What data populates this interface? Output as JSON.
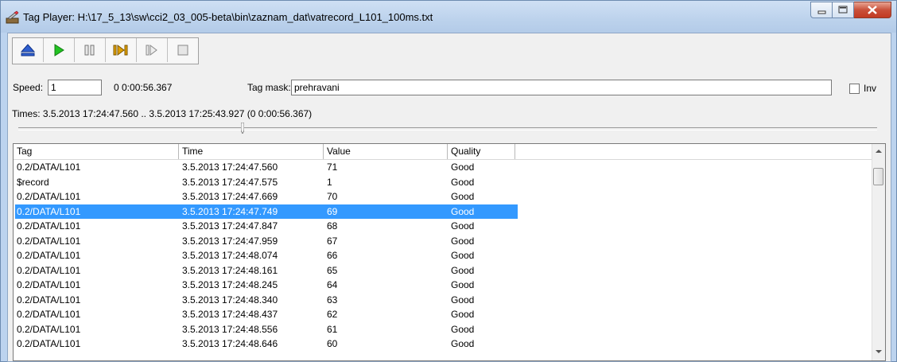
{
  "window": {
    "title": "Tag Player: H:\\17_5_13\\sw\\cci2_03_005-beta\\bin\\zaznam_dat\\vatrecord_L101_100ms.txt"
  },
  "toolbar": {
    "buttons": [
      "eject-icon",
      "play-icon",
      "pause-icon",
      "step-forward-icon",
      "step-icon",
      "stop-icon"
    ]
  },
  "controls": {
    "speed_label": "Speed:",
    "speed_value": "1",
    "position": "0 0:00:56.367",
    "tag_mask_label": "Tag mask:",
    "tag_mask_value": "prehravani",
    "inv_label": "Inv"
  },
  "times": "Times:  3.5.2013 17:24:47.560 .. 3.5.2013 17:25:43.927 (0 0:00:56.367)",
  "table": {
    "columns": [
      "Tag",
      "Time",
      "Value",
      "Quality"
    ],
    "rows": [
      [
        "0.2/DATA/L101",
        "3.5.2013 17:24:47.560",
        "71",
        "Good"
      ],
      [
        "$record",
        "3.5.2013 17:24:47.575",
        "1",
        "Good"
      ],
      [
        "0.2/DATA/L101",
        "3.5.2013 17:24:47.669",
        "70",
        "Good"
      ],
      [
        "0.2/DATA/L101",
        "3.5.2013 17:24:47.749",
        "69",
        "Good"
      ],
      [
        "0.2/DATA/L101",
        "3.5.2013 17:24:47.847",
        "68",
        "Good"
      ],
      [
        "0.2/DATA/L101",
        "3.5.2013 17:24:47.959",
        "67",
        "Good"
      ],
      [
        "0.2/DATA/L101",
        "3.5.2013 17:24:48.074",
        "66",
        "Good"
      ],
      [
        "0.2/DATA/L101",
        "3.5.2013 17:24:48.161",
        "65",
        "Good"
      ],
      [
        "0.2/DATA/L101",
        "3.5.2013 17:24:48.245",
        "64",
        "Good"
      ],
      [
        "0.2/DATA/L101",
        "3.5.2013 17:24:48.340",
        "63",
        "Good"
      ],
      [
        "0.2/DATA/L101",
        "3.5.2013 17:24:48.437",
        "62",
        "Good"
      ],
      [
        "0.2/DATA/L101",
        "3.5.2013 17:24:48.556",
        "61",
        "Good"
      ],
      [
        "0.2/DATA/L101",
        "3.5.2013 17:24:48.646",
        "60",
        "Good"
      ]
    ],
    "selected_row": 3
  },
  "colors": {
    "selection": "#3399ff",
    "play": "#1db31d",
    "eject": "#2255cc",
    "step": "#c98a00"
  }
}
